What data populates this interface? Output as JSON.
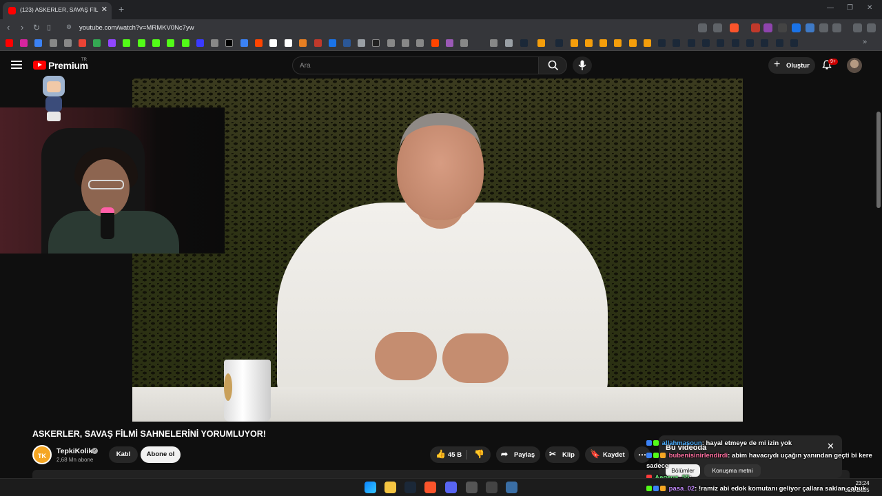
{
  "browser": {
    "tab_title": "(123) ASKERLER, SAVAŞ FİLMİ SAHNELERİNİ YORUMLUYOR!",
    "url": "youtube.com/watch?v=MRMKV0Nc7yw",
    "colors": {
      "tabbar": "#202124",
      "toolbar": "#35363a"
    }
  },
  "youtube": {
    "brand": "Premium",
    "region": "TR",
    "search_placeholder": "Ara",
    "create_label": "Oluştur",
    "notifications_badge": "9+"
  },
  "video": {
    "title": "ASKERLER, SAVAŞ FİLMİ SAHNELERİNİ YORUMLUYOR!",
    "channel": {
      "name": "TepkiKolik",
      "avatar_text": "TK",
      "subscribers": "2,68 Mn abone",
      "join_label": "Katıl",
      "subscribe_label": "Abone ol"
    },
    "actions": {
      "likes": "45 B",
      "share": "Paylaş",
      "clip": "Klip",
      "save": "Kaydet",
      "more": "⋯"
    }
  },
  "chat_panel": {
    "header": "Bu videoda",
    "chips": [
      "Bölümler",
      "Konuşma metni"
    ],
    "close": "✕"
  },
  "chat_messages": [
    {
      "user": "allahmasoun",
      "text": ": hayal etmeye de mi izin yok"
    },
    {
      "user": "bubenisinirlendirdi",
      "text": ": abim havacıydı uçağın yanından geçti bi kere"
    },
    {
      "user": "sadece",
      "text": ""
    },
    {
      "user": "Aegeus_55",
      "text": ":"
    },
    {
      "user": "pasa_02",
      "text": ": !ramiz abi edok komutanı geliyor çallara saklan çabuk"
    }
  ],
  "taskbar": {
    "time": "23:24",
    "date": "3.06.2025"
  }
}
